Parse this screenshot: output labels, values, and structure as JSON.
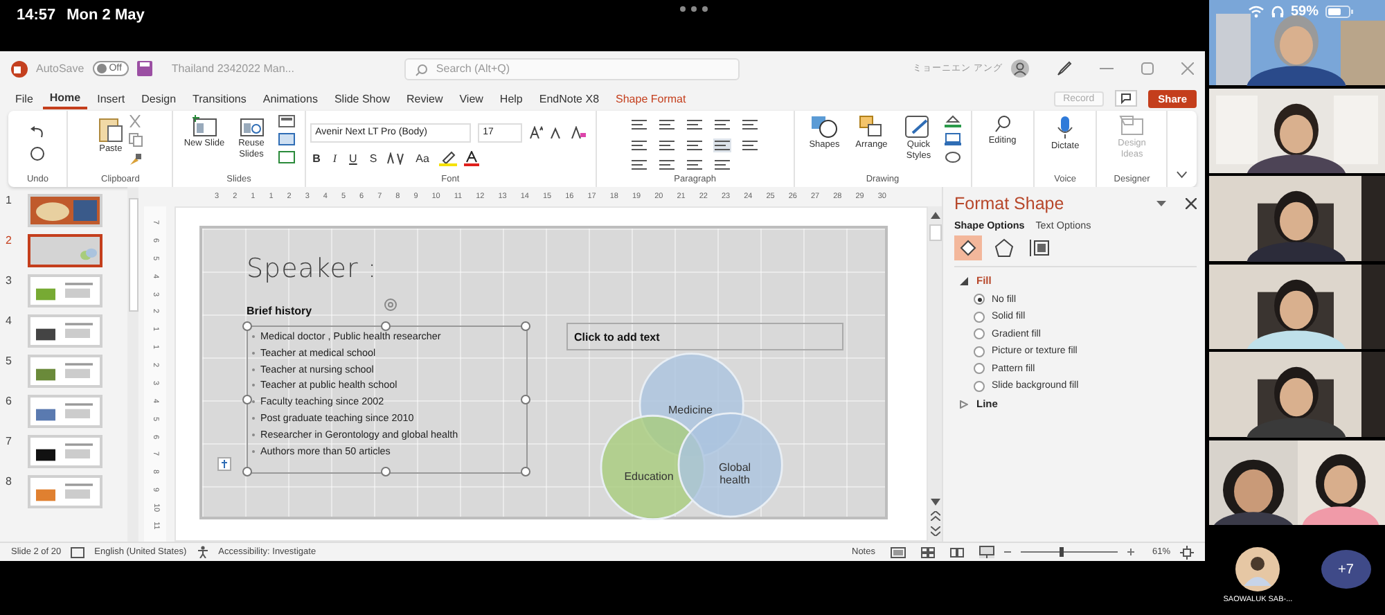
{
  "device_status": {
    "time": "14:57",
    "date": "Mon 2 May",
    "battery": "59%"
  },
  "title_bar": {
    "autosave": "AutoSave",
    "autosave_toggle": {
      "label": "Off",
      "on": false
    },
    "file_name": "Thailand 2342022 Man...",
    "search": {
      "placeholder": "Search (Alt+Q)"
    },
    "user": "ミョーニエン アング"
  },
  "tabs": [
    {
      "label": "File",
      "selected": false
    },
    {
      "label": "Home",
      "selected": true
    },
    {
      "label": "Insert",
      "selected": false
    },
    {
      "label": "Design",
      "selected": false
    },
    {
      "label": "Transitions",
      "selected": false
    },
    {
      "label": "Animations",
      "selected": false
    },
    {
      "label": "Slide Show",
      "selected": false
    },
    {
      "label": "Review",
      "selected": false
    },
    {
      "label": "View",
      "selected": false
    },
    {
      "label": "Help",
      "selected": false
    },
    {
      "label": "EndNote X8",
      "selected": false
    },
    {
      "label": "Shape Format",
      "selected": false,
      "contextual": true
    }
  ],
  "tab_actions": {
    "record": {
      "label": "Record",
      "disabled": true
    },
    "share": "Share"
  },
  "ribbon": {
    "undo": {
      "label": "Undo"
    },
    "clipboard": {
      "label": "Clipboard",
      "paste": "Paste"
    },
    "slides": {
      "label": "Slides",
      "buttons": [
        "New Slide",
        "Reuse Slides"
      ]
    },
    "font": {
      "label": "Font",
      "family": "Avenir Next LT Pro (Body)",
      "size": "17",
      "styles": [
        "B",
        "I",
        "U",
        "S"
      ],
      "case": "Aa"
    },
    "paragraph": {
      "label": "Paragraph"
    },
    "drawing": {
      "label": "Drawing",
      "buttons": [
        "Shapes",
        "Arrange",
        "Quick Styles"
      ]
    },
    "editing": {
      "button": "Editing"
    },
    "voice": {
      "label": "Voice",
      "button": "Dictate"
    },
    "designer": {
      "label": "Designer",
      "button": {
        "label": "Design Ideas",
        "disabled": true
      }
    }
  },
  "h_ruler": [
    "3",
    "2",
    "1",
    "1",
    "2",
    "3",
    "4",
    "5",
    "6",
    "7",
    "8",
    "9",
    "10",
    "11",
    "12",
    "13",
    "14",
    "15",
    "16",
    "17",
    "18",
    "19",
    "20",
    "21",
    "22",
    "23",
    "24",
    "25",
    "26",
    "27",
    "28",
    "29",
    "30"
  ],
  "v_ruler": [
    "7",
    "6",
    "5",
    "4",
    "3",
    "2",
    "1",
    "1",
    "2",
    "3",
    "4",
    "5",
    "6",
    "7",
    "8",
    "9",
    "10",
    "11"
  ],
  "thumbnails": [
    {
      "number": "1",
      "selected": false
    },
    {
      "number": "2",
      "selected": true
    },
    {
      "number": "3",
      "selected": false
    },
    {
      "number": "4",
      "selected": false
    },
    {
      "number": "5",
      "selected": false
    },
    {
      "number": "6",
      "selected": false
    },
    {
      "number": "7",
      "selected": false
    },
    {
      "number": "8",
      "selected": false
    }
  ],
  "slide": {
    "title": "Speaker :",
    "heading": "Brief history",
    "bullets": [
      "Medical doctor , Public health researcher",
      "Teacher at medical school",
      "Teacher at nursing school",
      "Teacher at public health school",
      "Faculty teaching since 2002",
      "Post graduate teaching since 2010",
      "Researcher in Gerontology and global health",
      "Authors more than 50 articles"
    ],
    "placeholder": "Click to add text",
    "venn": [
      {
        "label": "Medicine",
        "color": "#aac3de"
      },
      {
        "label": "Education",
        "color": "#a8cc7c"
      },
      {
        "label": "Global health",
        "color": "#aac3de"
      }
    ]
  },
  "format_panel": {
    "title": "Format Shape",
    "tabs": [
      {
        "label": "Shape Options",
        "selected": true
      },
      {
        "label": "Text Options",
        "selected": false
      }
    ],
    "sections": [
      {
        "label": "Fill",
        "expanded": true,
        "options": [
          {
            "label": "No fill",
            "selected": true
          },
          {
            "label": "Solid fill",
            "selected": false
          },
          {
            "label": "Gradient fill",
            "selected": false
          },
          {
            "label": "Picture or texture fill",
            "selected": false
          },
          {
            "label": "Pattern fill",
            "selected": false
          },
          {
            "label": "Slide background fill",
            "selected": false
          }
        ]
      },
      {
        "label": "Line",
        "expanded": false
      }
    ]
  },
  "status_bar": {
    "slide": "Slide 2 of 20",
    "language": "English (United States)",
    "accessibility": "Accessibility: Investigate",
    "notes": "Notes",
    "zoom": {
      "level": 0.42,
      "reading": "61%"
    }
  },
  "call": {
    "participant": "SAOWALUK SAB-...",
    "more": "+7"
  }
}
